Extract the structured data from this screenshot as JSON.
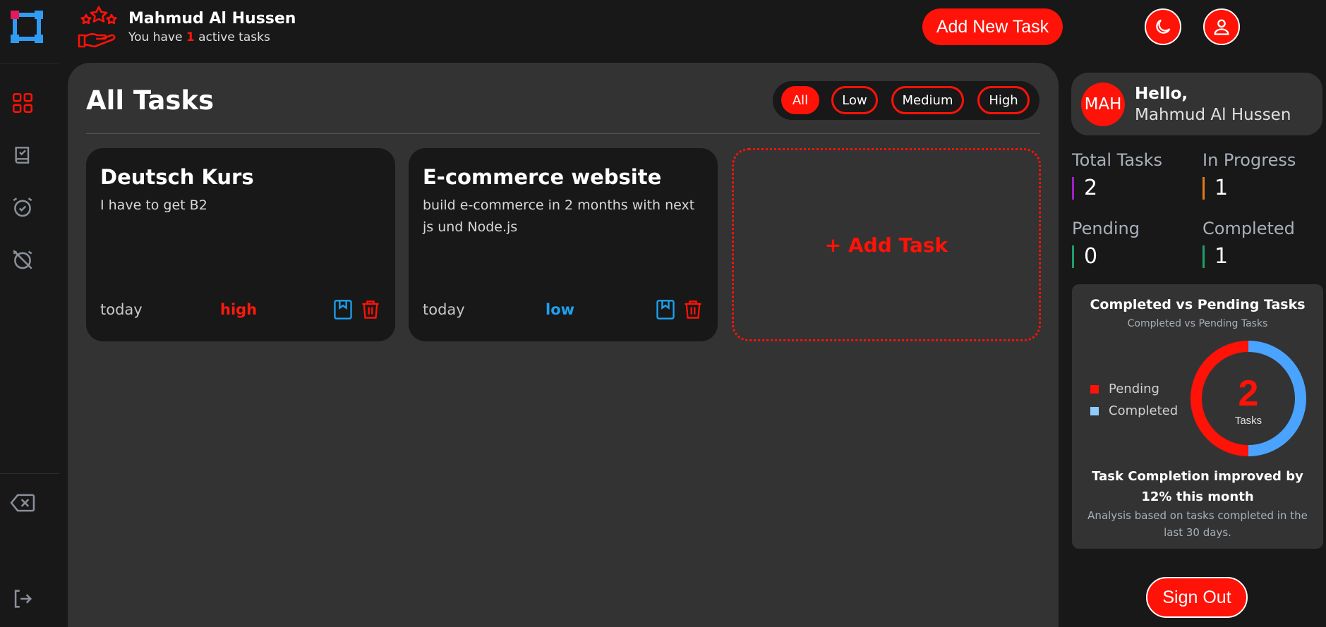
{
  "header": {
    "user_name": "Mahmud Al Hussen",
    "active_prefix": "You have",
    "active_count": "1",
    "active_suffix": "active tasks",
    "add_new_task_label": "Add New Task",
    "theme_icon": "moon-icon",
    "profile_icon": "user-icon"
  },
  "sidebar_nav": {
    "items": [
      {
        "icon": "grid-icon",
        "name": "all-tasks"
      },
      {
        "icon": "book-check-icon",
        "name": "completed"
      },
      {
        "icon": "alarm-clock-icon",
        "name": "pending"
      },
      {
        "icon": "alarm-off-icon",
        "name": "overdue"
      }
    ],
    "bottom": [
      {
        "icon": "delete-backspace-icon",
        "name": "delete-all"
      },
      {
        "icon": "logout-icon",
        "name": "logout"
      }
    ]
  },
  "main": {
    "title": "All Tasks",
    "filters": [
      "All",
      "Low",
      "Medium",
      "High"
    ],
    "active_filter": "All",
    "tasks": [
      {
        "title": "Deutsch Kurs",
        "description": "I have to get B2",
        "date": "today",
        "priority": "high"
      },
      {
        "title": "E-commerce website",
        "description": "build e-commerce in 2 months with next js und Node.js",
        "date": "today",
        "priority": "low"
      }
    ],
    "add_task_label": "+ Add Task"
  },
  "profile": {
    "initials": "MAH",
    "greeting": "Hello,",
    "name": "Mahmud Al Hussen"
  },
  "stats": {
    "total_label": "Total Tasks",
    "total": "2",
    "in_progress_label": "In Progress",
    "in_progress": "1",
    "pending_label": "Pending",
    "pending": "0",
    "completed_label": "Completed",
    "completed": "1"
  },
  "chart_data": {
    "type": "pie",
    "title": "Completed vs Pending Tasks",
    "subtitle": "Completed vs Pending Tasks",
    "categories": [
      "Pending",
      "Completed"
    ],
    "values": [
      1,
      1
    ],
    "colors": [
      "#ff1207",
      "#4aa3ff"
    ],
    "center_value": "2",
    "center_label": "Tasks"
  },
  "chart_footer": {
    "headline": "Task Completion improved by 12% this month",
    "note": "Analysis based on tasks completed in the last 30 days."
  },
  "signout_label": "Sign Out",
  "colors": {
    "accent": "#ff1207",
    "high": "#ff1a0d",
    "low": "#1da1f2",
    "total_bar": "#a01ec8",
    "progress_bar": "#e07b1a",
    "pending_bar": "#1e9e6a",
    "completed_bar": "#1e9e6a"
  }
}
